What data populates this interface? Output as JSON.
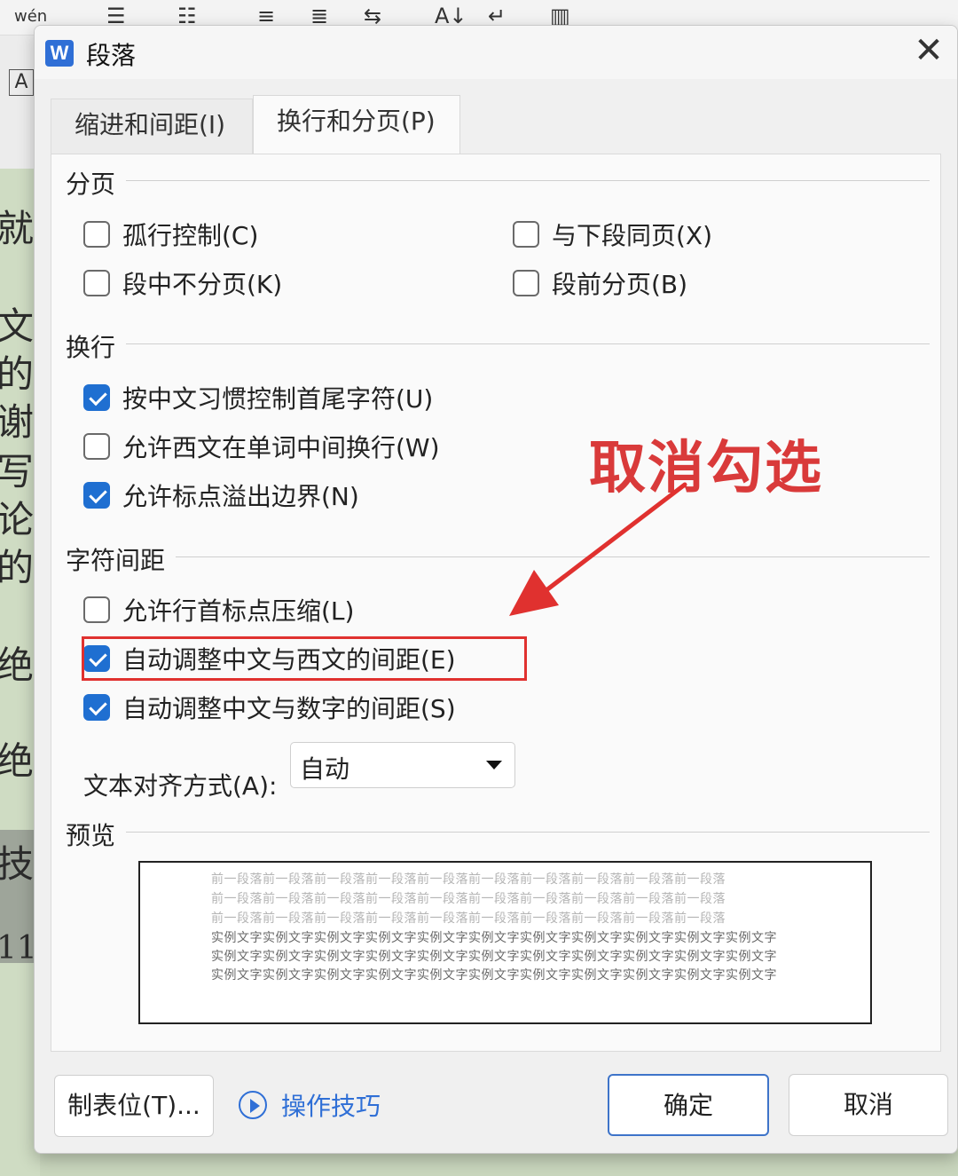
{
  "background": {
    "toolbar_hint": "wén",
    "side_chars": [
      "就",
      "文",
      "的",
      "谢",
      "写",
      "论",
      "的",
      "绝",
      "绝",
      "技.",
      "11"
    ],
    "ruler_label": "A"
  },
  "dialog": {
    "title": "段落",
    "app_icon": "W",
    "close": "✕",
    "tabs": [
      {
        "label": "缩进和间距(I)",
        "active": false
      },
      {
        "label": "换行和分页(P)",
        "active": true
      }
    ],
    "sections": {
      "pagination": {
        "title": "分页",
        "options": [
          {
            "label": "孤行控制(C)",
            "checked": false
          },
          {
            "label": "与下段同页(X)",
            "checked": false
          },
          {
            "label": "段中不分页(K)",
            "checked": false
          },
          {
            "label": "段前分页(B)",
            "checked": false
          }
        ]
      },
      "line_break": {
        "title": "换行",
        "options": [
          {
            "label": "按中文习惯控制首尾字符(U)",
            "checked": true
          },
          {
            "label": "允许西文在单词中间换行(W)",
            "checked": false
          },
          {
            "label": "允许标点溢出边界(N)",
            "checked": true
          }
        ]
      },
      "char_spacing": {
        "title": "字符间距",
        "options": [
          {
            "label": "允许行首标点压缩(L)",
            "checked": false
          },
          {
            "label": "自动调整中文与西文的间距(E)",
            "checked": true
          },
          {
            "label": "自动调整中文与数字的间距(S)",
            "checked": true
          }
        ],
        "text_alignment_label": "文本对齐方式(A):",
        "text_alignment_value": "自动"
      },
      "preview": {
        "title": "预览",
        "prev_line": "前一段落前一段落前一段落前一段落前一段落前一段落前一段落前一段落前一段落前一段落",
        "sample_line": "实例文字实例文字实例文字实例文字实例文字实例文字实例文字实例文字实例文字实例文字实例文字"
      }
    },
    "footer": {
      "tab_stops": "制表位(T)...",
      "tips": "操作技巧",
      "ok": "确定",
      "cancel": "取消"
    }
  },
  "annotation": {
    "text": "取消勾选",
    "color": "#e0312f"
  }
}
